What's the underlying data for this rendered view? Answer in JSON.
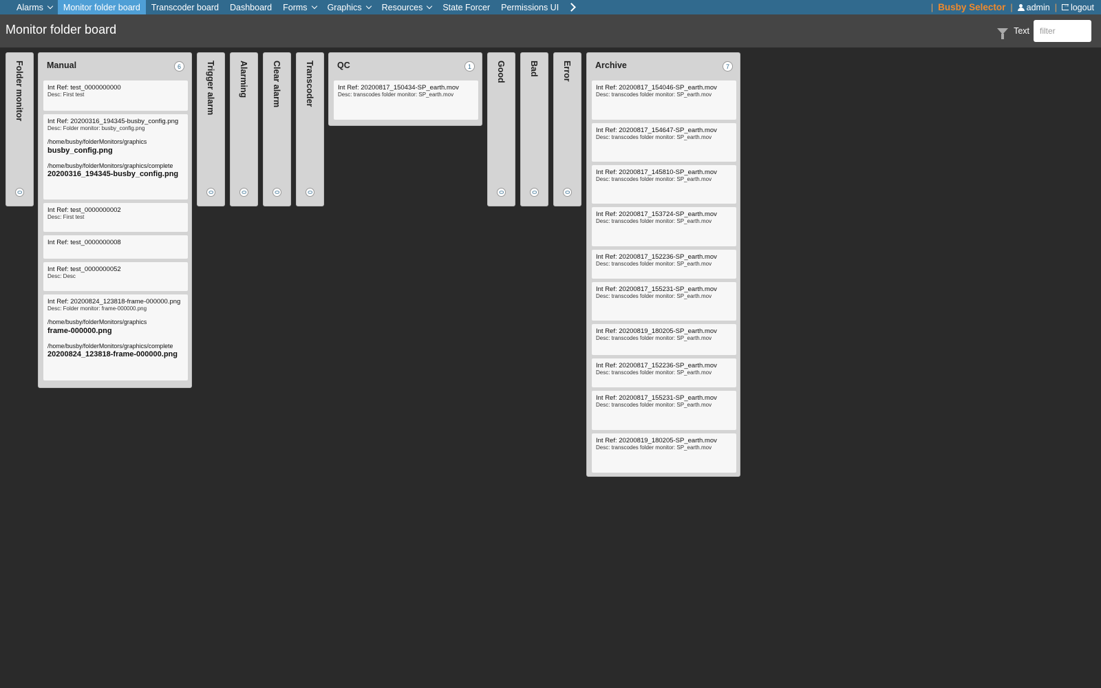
{
  "nav": {
    "items": [
      {
        "label": "Alarms",
        "caret": true,
        "active": false
      },
      {
        "label": "Monitor folder board",
        "caret": false,
        "active": true
      },
      {
        "label": "Transcoder board",
        "caret": false,
        "active": false
      },
      {
        "label": "Dashboard",
        "caret": false,
        "active": false
      },
      {
        "label": "Forms",
        "caret": true,
        "active": false
      },
      {
        "label": "Graphics",
        "caret": true,
        "active": false
      },
      {
        "label": "Resources",
        "caret": true,
        "active": false
      },
      {
        "label": "State Forcer",
        "caret": false,
        "active": false
      },
      {
        "label": "Permissions UI",
        "caret": false,
        "active": false
      }
    ],
    "separator": "|",
    "brand": "Busby Selector",
    "user": "admin",
    "logout": "logout"
  },
  "header": {
    "title": "Monitor folder board",
    "filter_label": "Text",
    "filter_placeholder": "filter",
    "filter_value": ""
  },
  "columns": {
    "folder_monitor": {
      "title": "Folder monitor",
      "count": "0"
    },
    "manual": {
      "title": "Manual",
      "count": "6",
      "cards": [
        {
          "ref": "Int Ref: test_0000000000",
          "desc": "Desc: First test"
        },
        {
          "ref": "Int Ref: 20200316_194345-busby_config.png",
          "desc": "Desc: Folder monitor: busby_config.png",
          "path1": "/home/busby/folderMonitors/graphics",
          "file1": "busby_config.png",
          "path2": "/home/busby/folderMonitors/graphics/complete",
          "file2": "20200316_194345-busby_config.png"
        },
        {
          "ref": "Int Ref: test_0000000002",
          "desc": "Desc: First test"
        },
        {
          "ref": "Int Ref: test_0000000008"
        },
        {
          "ref": "Int Ref: test_0000000052",
          "desc": "Desc: Desc"
        },
        {
          "ref": "Int Ref: 20200824_123818-frame-000000.png",
          "desc": "Desc: Folder monitor: frame-000000.png",
          "path1": "/home/busby/folderMonitors/graphics",
          "file1": "frame-000000.png",
          "path2": "/home/busby/folderMonitors/graphics/complete",
          "file2": "20200824_123818-frame-000000.png"
        }
      ]
    },
    "trigger_alarm": {
      "title": "Trigger alarm",
      "count": "0"
    },
    "alarming": {
      "title": "Alarming",
      "count": "0"
    },
    "clear_alarm": {
      "title": "Clear alarm",
      "count": "0"
    },
    "transcoder": {
      "title": "Transcoder",
      "count": "0"
    },
    "qc": {
      "title": "QC",
      "count": "1",
      "cards": [
        {
          "ref": "Int Ref: 20200817_150434-SP_earth.mov",
          "desc": "Desc: transcodes folder monitor: SP_earth.mov"
        }
      ]
    },
    "good": {
      "title": "Good",
      "count": "0"
    },
    "bad": {
      "title": "Bad",
      "count": "0"
    },
    "error": {
      "title": "Error",
      "count": "0"
    },
    "archive": {
      "title": "Archive",
      "count": "7",
      "cards": [
        {
          "ref": "Int Ref: 20200817_154046-SP_earth.mov",
          "desc": "Desc: transcodes folder monitor: SP_earth.mov"
        },
        {
          "ref": "Int Ref: 20200817_154647-SP_earth.mov",
          "desc": "Desc: transcodes folder monitor: SP_earth.mov"
        },
        {
          "ref": "Int Ref: 20200817_145810-SP_earth.mov",
          "desc": "Desc: transcodes folder monitor: SP_earth.mov"
        },
        {
          "ref": "Int Ref: 20200817_153724-SP_earth.mov",
          "desc": "Desc: transcodes folder monitor: SP_earth.mov"
        },
        {
          "ref": "Int Ref: 20200817_152236-SP_earth.mov",
          "desc": "Desc: transcodes folder monitor: SP_earth.mov"
        },
        {
          "ref": "Int Ref: 20200817_155231-SP_earth.mov",
          "desc": "Desc: transcodes folder monitor: SP_earth.mov"
        },
        {
          "ref": "Int Ref: 20200819_180205-SP_earth.mov",
          "desc": "Desc: transcodes folder monitor: SP_earth.mov"
        },
        {
          "ref": "Int Ref: 20200817_152236-SP_earth.mov",
          "desc": "Desc: transcodes folder monitor: SP_earth.mov"
        },
        {
          "ref": "Int Ref: 20200817_155231-SP_earth.mov",
          "desc": "Desc: transcodes folder monitor: SP_earth.mov"
        },
        {
          "ref": "Int Ref: 20200819_180205-SP_earth.mov",
          "desc": "Desc: transcodes folder monitor: SP_earth.mov"
        }
      ]
    }
  }
}
